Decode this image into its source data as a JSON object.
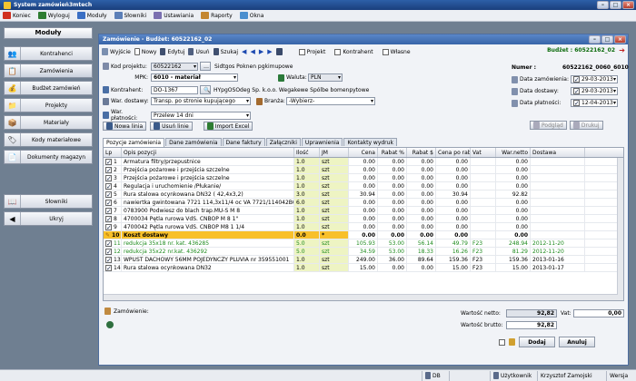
{
  "app": {
    "title": "System zamówień3mtech"
  },
  "menu": [
    {
      "label": "Koniec",
      "icon": "exit-icon",
      "color": "#d03020"
    },
    {
      "label": "Wyloguj",
      "icon": "logout-icon",
      "color": "#2e7d32"
    },
    {
      "label": "Moduły",
      "icon": "modules-icon",
      "color": "#3a6fc4"
    },
    {
      "label": "Słowniki",
      "icon": "dictionary-icon",
      "color": "#5b7fb8"
    },
    {
      "label": "Ustawiania",
      "icon": "settings-icon",
      "color": "#7a6fb0"
    },
    {
      "label": "Raporty",
      "icon": "reports-icon",
      "color": "#c4862f"
    },
    {
      "label": "Okna",
      "icon": "windows-icon",
      "color": "#4a8fcf"
    }
  ],
  "sidebar": {
    "header": "Moduły",
    "items": [
      {
        "label": "Kontrahenci",
        "icon": "contacts-icon"
      },
      {
        "label": "Zamówienia",
        "icon": "orders-icon"
      },
      {
        "label": "Budżet zamówień",
        "icon": "budget-icon"
      },
      {
        "label": "Projekty",
        "icon": "projects-icon"
      },
      {
        "label": "Materiały",
        "icon": "materials-icon"
      },
      {
        "label": "Kody materiałowe",
        "icon": "codes-icon"
      },
      {
        "label": "Dokumenty magazyn",
        "icon": "warehouse-icon"
      },
      {
        "label": "Słowniki",
        "icon": "dictionary-icon"
      },
      {
        "label": "Ukryj",
        "icon": "hide-icon"
      }
    ]
  },
  "order": {
    "window_title": "Zamówienie - Budżet: 60522162_02",
    "budzet_label": "Budżet : 60522162_02",
    "toolbar": {
      "exit": "Wyjście",
      "new": "Nowy",
      "edit": "Edytuj",
      "delete": "Usuń",
      "search": "Szukaj",
      "projekt": "Projekt",
      "kontrahent": "Kontrahent",
      "wlasne": "Własne"
    },
    "fields": {
      "kod_projektu_label": "Kod projektu:",
      "kod_projektu": "60522162",
      "kod_projektu_desc": "Sidtgos Poknen pgkimupowe",
      "mpk_label": "MPK:",
      "mpk": "6010 - materiał",
      "waluta_label": "Waluta:",
      "waluta": "PLN",
      "kontrahent_label": "Kontrahent:",
      "kontrahent_code": "DO-1367",
      "kontrahent_name": "HYpgOSOdeg Sp. k.o.o. Wegakewe Spólbe bomenpytowe",
      "war_dostawy_label": "War. dostawy:",
      "war_dostawy": "Transp. po stronie kupującego",
      "branza_label": "Branża:",
      "branza": "-Wybierz-",
      "war_platnosci_label": "War. płatności:",
      "war_platnosci": "Przelew 14 dni",
      "numer_label": "Numer :",
      "numer": "60522162_0060_6010",
      "data_zamowienia_label": "Data zamówienia:",
      "data_zamowienia": "29-03-2013",
      "data_dostawy_label": "Data dostawy:",
      "data_dostawy": "29-03-2013",
      "data_platnosci_label": "Data płatności:",
      "data_platnosci": "12-04-2013"
    },
    "buttons": {
      "nowa_linia": "Nowa linia",
      "usun_linie": "Usuń linie",
      "import_excel": "Import Excel",
      "podglad": "Podgląd",
      "drukuj": "Drukuj"
    },
    "tabs": [
      "Pozycje zamówienia",
      "Dane zamówienia",
      "Dane faktury",
      "Załączniki",
      "Uprawnienia",
      "Kontakty wydruk"
    ],
    "columns": [
      "Lp",
      "Opis pozycji",
      "Ilość",
      "JM",
      "Cena",
      "Rabat %",
      "Rabat $",
      "Cena po rab",
      "Vat",
      "War.netto",
      "Dostawa"
    ],
    "rows": [
      [
        "1",
        "Armatura filtry/przepustnice",
        "1.0",
        "szt",
        "0.00",
        "0.00",
        "0.00",
        "0.00",
        "",
        "0.00",
        ""
      ],
      [
        "2",
        "Przejścia pożarowe i przejścia szczelne",
        "1.0",
        "szt",
        "0.00",
        "0.00",
        "0.00",
        "0.00",
        "",
        "0.00",
        ""
      ],
      [
        "3",
        "Przejścia pożarowe i przejścia szczelne",
        "1.0",
        "szt",
        "0.00",
        "0.00",
        "0.00",
        "0.00",
        "",
        "0.00",
        ""
      ],
      [
        "4",
        "Regulacja i uruchomienie /Płukanie/",
        "1.0",
        "szt",
        "0.00",
        "0.00",
        "0.00",
        "0.00",
        "",
        "0.00",
        ""
      ],
      [
        "5",
        "Rura stalowa ocynkowana DN32 ( 42,4x3,2)",
        "3.0",
        "szt",
        "30.94",
        "0.00",
        "0.00",
        "30.94",
        "",
        "92.82",
        ""
      ],
      [
        "6",
        "nawiertka gwintowana 7721 114,3x11/4 oc VA 7721/114042BG",
        "6.0",
        "szt",
        "0.00",
        "0.00",
        "0.00",
        "0.00",
        "",
        "0.00",
        ""
      ],
      [
        "7",
        "0783900 Podwiesz do blach trap.MU-S M 8",
        "1.0",
        "szt",
        "0.00",
        "0.00",
        "0.00",
        "0.00",
        "",
        "0.00",
        ""
      ],
      [
        "8",
        "4700034 Pętla rurowa VdS. CNBOP M 8 1\"",
        "1.0",
        "szt",
        "0.00",
        "0.00",
        "0.00",
        "0.00",
        "",
        "0.00",
        ""
      ],
      [
        "9",
        "4700042 Pętla rurowa VdS. CNBOP M8 1 1/4",
        "1.0",
        "szt",
        "0.00",
        "0.00",
        "0.00",
        "0.00",
        "",
        "0.00",
        ""
      ],
      [
        "10",
        "Koszt dostawy",
        "0.0",
        "*",
        "0.00",
        "0.00",
        "0.00",
        "0.00",
        "",
        "0.00",
        ""
      ],
      [
        "11",
        "redukcja 35x18 nr. kat. 436285",
        "5.0",
        "szt",
        "105.93",
        "53.00",
        "56.14",
        "49.79",
        "F23",
        "248.94",
        "2012-11-20"
      ],
      [
        "12",
        "redukcja 35x22 nr.kat. 436292",
        "5.0",
        "szt",
        "34.59",
        "53.00",
        "18.33",
        "16.26",
        "F23",
        "81.29",
        "2012-11-20"
      ],
      [
        "13",
        "WPUST DACHOWY 56MM POJEDYNCZY PLUVIA nr 359551001",
        "1.0",
        "szt",
        "249.00",
        "36.00",
        "89.64",
        "159.36",
        "F23",
        "159.36",
        "2013-01-16"
      ],
      [
        "14",
        "Rura stalowa ocynkowana DN32",
        "1.0",
        "szt",
        "15.00",
        "0.00",
        "0.00",
        "15.00",
        "F23",
        "15.00",
        "2013-01-17"
      ]
    ],
    "footer": {
      "zamowienie_label": "Zamówienie:",
      "wartosc_netto_label": "Wartość netto:",
      "wartosc_netto": "92,82",
      "vat_label": "Vat:",
      "vat": "0,00",
      "wartosc_brutto_label": "Wartość brutto:",
      "wartosc_brutto": "92,82",
      "dodaj": "Dodaj",
      "anuluj": "Anuluj"
    }
  },
  "status": {
    "db": "DB",
    "user_label": "Użytkownik",
    "user": "Krzysztof Zamojski",
    "wersja": "Wersja"
  }
}
